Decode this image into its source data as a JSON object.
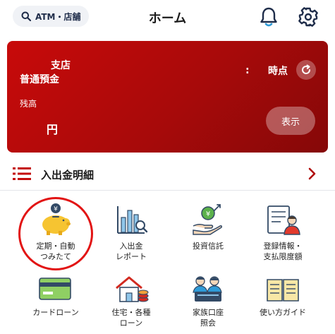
{
  "header": {
    "search_label": "ATM・店舗",
    "title": "ホーム"
  },
  "account": {
    "branch": "支店",
    "account_type": "普通預金",
    "time_colon": ":",
    "time_label": "時点",
    "balance_label": "残高",
    "currency": "円",
    "show_button": "表示"
  },
  "history": {
    "label": "入出金明細"
  },
  "menu": {
    "items": [
      {
        "label": "定期・自動\nつみたて",
        "icon": "piggy-bank-icon"
      },
      {
        "label": "入出金\nレポート",
        "icon": "report-chart-icon"
      },
      {
        "label": "投資信託",
        "icon": "investment-trust-icon"
      },
      {
        "label": "登録情報・\n支払限度額",
        "icon": "registration-info-icon"
      },
      {
        "label": "カードローン",
        "icon": "card-loan-icon"
      },
      {
        "label": "住宅・各種\nローン",
        "icon": "housing-loan-icon"
      },
      {
        "label": "家族口座\n照会",
        "icon": "family-account-icon"
      },
      {
        "label": "使い方ガイド",
        "icon": "guide-book-icon"
      }
    ]
  },
  "colors": {
    "brand_red": "#b80a0a",
    "highlight_ring": "#e21414",
    "navy": "#1f2d4a"
  }
}
